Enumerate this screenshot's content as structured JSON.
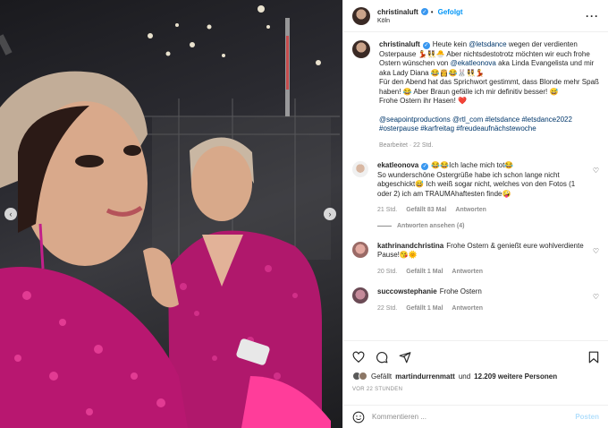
{
  "post_author": {
    "username": "christinaluft",
    "verified": true,
    "follow_status": "Gefolgt",
    "separator": "•",
    "location": "Köln"
  },
  "caption": {
    "username": "christinaluft",
    "verified": true,
    "text_1": "Heute kein ",
    "mention_letsdance": "@letsdance",
    "text_2": " wegen der verdienten Osterpause 💃👯‍♀️🐣 Aber nichtsdestotrotz möchten wir euch frohe Ostern wünschen von ",
    "mention_ekat": "@ekatleonova",
    "text_3": " aka Linda Evangelista und mir aka Lady Diana 😂👸😂🐰👯‍♀️💃\nFür den Abend hat das Sprichwort gestimmt, dass Blonde mehr Spaß haben! 😂 Aber Braun gefälle ich mir definitiv besser! 😅\nFrohe Ostern ihr Hasen! ❤️",
    "tags_1": "@seapointproductions @rtl_com #letsdance #letsdance2022",
    "tags_2": "#osterpause #karfreitag #freudeaufnächstewoche",
    "edited": "Bearbeitet · 22 Std."
  },
  "comments": [
    {
      "username": "ekatleonova",
      "verified": true,
      "text": "😂😂Ich lache mich tot😂\nSo wunderschöne Ostergrüße habe ich schon lange nicht abgeschickt😅 Ich weiß sogar nicht, welches von den Fotos (1 oder 2) ich am TRAUMAhaftesten finde🤪",
      "time": "21 Std.",
      "likes": "Gefällt 83 Mal",
      "reply": "Antworten",
      "view_replies": "Antworten ansehen (4)"
    },
    {
      "username": "kathrinandchristina",
      "verified": false,
      "text": "Frohe Ostern & genießt eure wohlverdiente Pause!😘🌞",
      "time": "20 Std.",
      "likes": "Gefällt 1 Mal",
      "reply": "Antworten"
    },
    {
      "username": "succowstephanie",
      "verified": false,
      "text": "Frohe Ostern",
      "time": "22 Std.",
      "likes": "Gefällt 1 Mal",
      "reply": "Antworten"
    }
  ],
  "liked_by": {
    "prefix": "Gefällt",
    "user": "martindurrenmatt",
    "conjunction": "und",
    "others": "12.209 weitere Personen"
  },
  "time_ago": "VOR 22 STUNDEN",
  "comment_input": {
    "placeholder": "Kommentieren ...",
    "post_label": "Posten"
  },
  "icons": {
    "more": "more-options-icon",
    "like": "heart-icon",
    "comment": "comment-icon",
    "share": "share-icon",
    "save": "bookmark-icon",
    "emoji": "emoji-icon",
    "prev": "chevron-left-icon",
    "next": "chevron-right-icon"
  },
  "colors": {
    "link": "#00376b",
    "verified": "#3897f0",
    "follow": "#0095f6",
    "muted": "#8e8e8e"
  }
}
